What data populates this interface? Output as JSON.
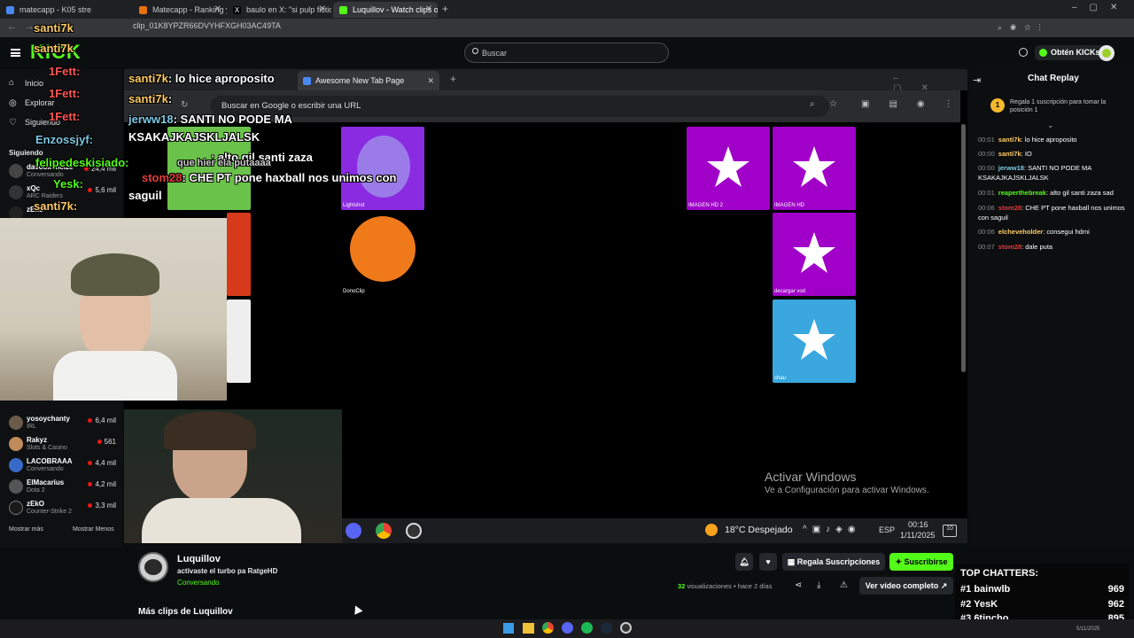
{
  "browser": {
    "tabs": [
      {
        "label": "matecapp - K05 stre",
        "color": "#4a8af4"
      },
      {
        "label": "Matecapp - Ranking y Racha d",
        "color": "#e8710a"
      },
      {
        "label": "baulo en X: \"si pulp fiction no s",
        "color": "#ffffff"
      },
      {
        "label": "Luquillov - Watch clips on K",
        "color": "#53fc18"
      }
    ],
    "url": "clip_01K8YPZR66DVYHFXGH03AC49TA"
  },
  "kick": {
    "logo": "KICK",
    "search_placeholder": "Buscar",
    "get_kicks": "Obtén KICKs"
  },
  "sidebar": {
    "nav": [
      "Inicio",
      "Explorar",
      "Siguiendo"
    ],
    "section": "Siguiendo",
    "channels_top": [
      {
        "name": "davooxeneize",
        "category": "Conversando",
        "viewers": "24,4 mil"
      },
      {
        "name": "xQc",
        "category": "ARC Raiders",
        "viewers": "5,6 mil"
      },
      {
        "name": "zEko",
        "category": "",
        "viewers": ""
      }
    ],
    "channels": [
      {
        "name": "yosoychanty",
        "category": "IRL",
        "viewers": "6,4 mil",
        "avcolor": "#6a5a4a"
      },
      {
        "name": "Rakyz",
        "category": "Slots & Casino",
        "viewers": "561",
        "avcolor": "#c08a5a"
      },
      {
        "name": "LACOBRAAA",
        "category": "Conversando",
        "viewers": "4,4 mil",
        "avcolor": "#3a6ac8"
      },
      {
        "name": "ElMacarius",
        "category": "Dota 2",
        "viewers": "4,2 mil",
        "avcolor": "#555555"
      },
      {
        "name": "zEkO",
        "category": "Counter-Strike 2",
        "viewers": "3,3 mil",
        "avcolor": "#1a1a1a"
      }
    ],
    "show_more": "Mostrar más",
    "show_less": "Mostrar Menos"
  },
  "player": {
    "inner_tab": "Awesome New Tab Page",
    "inner_url_placeholder": "Buscar en Google o escribir una URL",
    "tiles": [
      {
        "label": "Lightshot",
        "color": "#8a2be2"
      },
      {
        "label": "DonoClip",
        "color": "#8a2be2"
      },
      {
        "label": "IMAGEN HD 2",
        "color": "#a000c8"
      },
      {
        "label": "IMAGEN HD",
        "color": "#a000c8"
      },
      {
        "label": "decargar vod",
        "color": "#a000c8"
      },
      {
        "label": "chau",
        "color": "#3aa7de"
      }
    ],
    "watermark_title": "Activar Windows",
    "watermark_sub": "Ve a Configuración para activar Windows.",
    "weather": "18°C  Despejado",
    "lang": "ESP",
    "time": "00:16",
    "date": "1/11/2025",
    "notif_count": "10"
  },
  "overlay_chat": [
    {
      "user": "santi7k",
      "text": ": lo hice aproposito",
      "color": "#ffcc66"
    },
    {
      "user": "santi7k",
      "text": ":",
      "color": "#ffcc66"
    },
    {
      "user": "jerww18",
      "text": ": SANTI NO PODE MA",
      "color": "#7ec8e3"
    },
    {
      "user": "",
      "text": "KSAKAJKAJSKLJALSK",
      "color": "#ffffff"
    },
    {
      "user": "",
      "text": ": alto gil santi zaza",
      "color": "#ffffff"
    },
    {
      "user": "stom28",
      "text": ": CHE PT pone haxball nos unimos con",
      "color": "#e33b3b"
    },
    {
      "user": "",
      "text": "saguil",
      "color": "#ffffff"
    }
  ],
  "overlay_left": [
    {
      "text": "santi7k",
      "color": "#ffcc66"
    },
    {
      "text": "santi7k",
      "color": "#ffcc66"
    },
    {
      "text": "1Fett:",
      "color": "#ff5555"
    },
    {
      "text": "1Fett:",
      "color": "#ff5555"
    },
    {
      "text": "1Fett:",
      "color": "#ff5555"
    },
    {
      "text": "Enzossjyf:",
      "color": "#7ec8e3"
    },
    {
      "text": "felipedeskisiado:",
      "color": "#53fc18"
    },
    {
      "text": "Yesk:",
      "color": "#53fc18"
    },
    {
      "text": "santi7k:",
      "color": "#ffcc66"
    }
  ],
  "overlay_extra": [
    "que hier ela putaaaa"
  ],
  "chat": {
    "title": "Chat Replay",
    "pinned_text": "Regala 1 suscripción para tomar la posición 1",
    "pinned_rank": "1",
    "messages": [
      {
        "time": "00:01",
        "user": "santi7k",
        "color": "#ffcc66",
        "text": "lo hice aproposito"
      },
      {
        "time": "00:00",
        "user": "santi7k",
        "color": "#ffcc66",
        "text": "IO"
      },
      {
        "time": "00:00",
        "user": "jerww18",
        "color": "#7ec8e3",
        "text": "SANTI NO PODE MA KSAKAJKAJSKLJALSK"
      },
      {
        "time": "00:01",
        "user": "reaperthebreak",
        "color": "#53fc18",
        "text": "alto gil santi zaza sad"
      },
      {
        "time": "00:06",
        "user": "stom28",
        "color": "#e33b3b",
        "text": "CHE PT pone haxball nos unimos con saguil"
      },
      {
        "time": "00:06",
        "user": "elcheveholder",
        "color": "#ffcc66",
        "text": "consegui hdmi"
      },
      {
        "time": "00:07",
        "user": "stom28",
        "color": "#e33b3b",
        "text": "dale puta"
      }
    ]
  },
  "clip": {
    "channel": "Luquillov",
    "title": "activaste el turbo pa RatgeHD",
    "category": "Conversando",
    "gift_subs": "Regala Suscripciones",
    "subscribe": "Suscribirse",
    "views_count": "32",
    "views_label": "visualizaciones",
    "age": "• hace 2 días",
    "full_video": "Ver vídeo completo",
    "more_clips": "Más clips de Luquillov"
  },
  "top_chatters": {
    "title": "TOP CHATTERS:",
    "rows": [
      {
        "rank": "#1",
        "name": "bainwlb",
        "value": "969"
      },
      {
        "rank": "#2",
        "name": "YesK",
        "value": "962"
      },
      {
        "rank": "#3",
        "name": "6tincho",
        "value": "895"
      }
    ]
  },
  "taskbar": {
    "time": "",
    "date": "5/11/2025"
  }
}
